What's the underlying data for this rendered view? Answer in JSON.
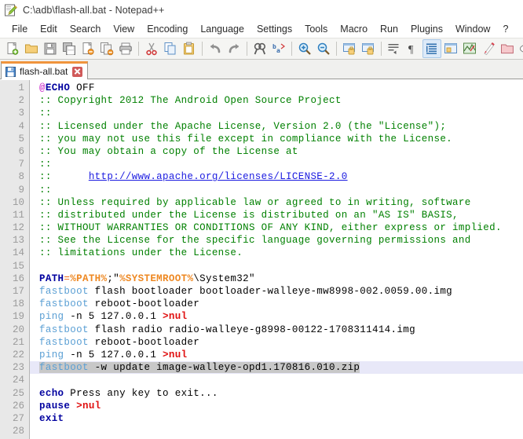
{
  "window": {
    "title": "C:\\adb\\flash-all.bat - Notepad++",
    "app_icon": "notepad-plus-plus-icon"
  },
  "menubar": {
    "items": [
      {
        "label": "File"
      },
      {
        "label": "Edit"
      },
      {
        "label": "Search"
      },
      {
        "label": "View"
      },
      {
        "label": "Encoding"
      },
      {
        "label": "Language"
      },
      {
        "label": "Settings"
      },
      {
        "label": "Tools"
      },
      {
        "label": "Macro"
      },
      {
        "label": "Run"
      },
      {
        "label": "Plugins"
      },
      {
        "label": "Window"
      },
      {
        "label": "?"
      }
    ]
  },
  "toolbar": {
    "buttons": [
      {
        "name": "new-file-icon"
      },
      {
        "name": "open-file-icon"
      },
      {
        "name": "save-icon"
      },
      {
        "name": "save-all-icon"
      },
      {
        "name": "close-file-icon"
      },
      {
        "name": "close-all-files-icon"
      },
      {
        "name": "print-icon"
      },
      {
        "name": "separator"
      },
      {
        "name": "cut-icon"
      },
      {
        "name": "copy-icon"
      },
      {
        "name": "paste-icon"
      },
      {
        "name": "separator"
      },
      {
        "name": "undo-icon"
      },
      {
        "name": "redo-icon"
      },
      {
        "name": "separator"
      },
      {
        "name": "find-icon"
      },
      {
        "name": "replace-icon"
      },
      {
        "name": "separator"
      },
      {
        "name": "zoom-in-icon"
      },
      {
        "name": "zoom-out-icon"
      },
      {
        "name": "separator"
      },
      {
        "name": "sync-vertical-scrolling-icon"
      },
      {
        "name": "sync-horizontal-scrolling-icon"
      },
      {
        "name": "separator"
      },
      {
        "name": "word-wrap-icon"
      },
      {
        "name": "show-all-characters-icon"
      },
      {
        "name": "indent-guide-icon"
      },
      {
        "name": "user-defined-language-icon"
      },
      {
        "name": "document-map-icon"
      },
      {
        "name": "function-list-icon"
      },
      {
        "name": "folder-as-workspace-icon"
      },
      {
        "name": "monitoring-icon"
      },
      {
        "name": "separator"
      },
      {
        "name": "record-macro-icon"
      }
    ]
  },
  "tabbar": {
    "tabs": [
      {
        "label": "flash-all.bat",
        "icon": "saved-file-icon",
        "close": "close-tab-icon",
        "active": true
      }
    ]
  },
  "editor": {
    "current_line": 23,
    "lines": [
      {
        "n": 1,
        "tokens": [
          {
            "t": "at",
            "s": "@"
          },
          {
            "t": "kw",
            "s": "ECHO"
          },
          {
            "t": "plain",
            "s": " OFF"
          }
        ]
      },
      {
        "n": 2,
        "tokens": [
          {
            "t": "cmt",
            "s": ":: Copyright 2012 The Android Open Source Project"
          }
        ]
      },
      {
        "n": 3,
        "tokens": [
          {
            "t": "cmt",
            "s": "::"
          }
        ]
      },
      {
        "n": 4,
        "tokens": [
          {
            "t": "cmt",
            "s": ":: Licensed under the Apache License, Version 2.0 (the \"License\");"
          }
        ]
      },
      {
        "n": 5,
        "tokens": [
          {
            "t": "cmt",
            "s": ":: you may not use this file except in compliance with the License."
          }
        ]
      },
      {
        "n": 6,
        "tokens": [
          {
            "t": "cmt",
            "s": ":: You may obtain a copy of the License at"
          }
        ]
      },
      {
        "n": 7,
        "tokens": [
          {
            "t": "cmt",
            "s": "::"
          }
        ]
      },
      {
        "n": 8,
        "tokens": [
          {
            "t": "cmt",
            "s": "::      "
          },
          {
            "t": "link",
            "s": "http://www.apache.org/licenses/LICENSE-2.0"
          }
        ]
      },
      {
        "n": 9,
        "tokens": [
          {
            "t": "cmt",
            "s": "::"
          }
        ]
      },
      {
        "n": 10,
        "tokens": [
          {
            "t": "cmt",
            "s": ":: Unless required by applicable law or agreed to in writing, software"
          }
        ]
      },
      {
        "n": 11,
        "tokens": [
          {
            "t": "cmt",
            "s": ":: distributed under the License is distributed on an \"AS IS\" BASIS,"
          }
        ]
      },
      {
        "n": 12,
        "tokens": [
          {
            "t": "cmt",
            "s": ":: WITHOUT WARRANTIES OR CONDITIONS OF ANY KIND, either express or implied."
          }
        ]
      },
      {
        "n": 13,
        "tokens": [
          {
            "t": "cmt",
            "s": ":: See the License for the specific language governing permissions and"
          }
        ]
      },
      {
        "n": 14,
        "tokens": [
          {
            "t": "cmt",
            "s": ":: limitations under the License."
          }
        ]
      },
      {
        "n": 15,
        "tokens": []
      },
      {
        "n": 16,
        "tokens": [
          {
            "t": "kw",
            "s": "PATH"
          },
          {
            "t": "op",
            "s": "="
          },
          {
            "t": "var",
            "s": "%PATH%"
          },
          {
            "t": "plain",
            "s": ";\""
          },
          {
            "t": "var",
            "s": "%SYSTEMROOT%"
          },
          {
            "t": "plain",
            "s": "\\System32\""
          }
        ]
      },
      {
        "n": 17,
        "tokens": [
          {
            "t": "cmd",
            "s": "fastboot"
          },
          {
            "t": "plain",
            "s": " flash bootloader bootloader-walleye-mw8998-002.0059.00.img"
          }
        ]
      },
      {
        "n": 18,
        "tokens": [
          {
            "t": "cmd",
            "s": "fastboot"
          },
          {
            "t": "plain",
            "s": " reboot-bootloader"
          }
        ]
      },
      {
        "n": 19,
        "tokens": [
          {
            "t": "cmd",
            "s": "ping"
          },
          {
            "t": "plain",
            "s": " -n 5 127.0.0.1 "
          },
          {
            "t": "red",
            "s": ">nul"
          }
        ]
      },
      {
        "n": 20,
        "tokens": [
          {
            "t": "cmd",
            "s": "fastboot"
          },
          {
            "t": "plain",
            "s": " flash radio radio-walleye-g8998-00122-1708311414.img"
          }
        ]
      },
      {
        "n": 21,
        "tokens": [
          {
            "t": "cmd",
            "s": "fastboot"
          },
          {
            "t": "plain",
            "s": " reboot-bootloader"
          }
        ]
      },
      {
        "n": 22,
        "tokens": [
          {
            "t": "cmd",
            "s": "ping"
          },
          {
            "t": "plain",
            "s": " -n 5 127.0.0.1 "
          },
          {
            "t": "red",
            "s": ">nul"
          }
        ]
      },
      {
        "n": 23,
        "tokens": [
          {
            "t": "cmd",
            "s": "fastboot",
            "sel": true
          },
          {
            "t": "plain",
            "s": " -w update image-walleye-opd1.170816.010.zip",
            "sel": true
          }
        ],
        "current": true
      },
      {
        "n": 24,
        "tokens": []
      },
      {
        "n": 25,
        "tokens": [
          {
            "t": "kw",
            "s": "echo"
          },
          {
            "t": "plain",
            "s": " Press any key to exit..."
          }
        ]
      },
      {
        "n": 26,
        "tokens": [
          {
            "t": "kw",
            "s": "pause"
          },
          {
            "t": "plain",
            "s": " "
          },
          {
            "t": "red",
            "s": ">nul"
          }
        ]
      },
      {
        "n": 27,
        "tokens": [
          {
            "t": "kw",
            "s": "exit"
          }
        ]
      },
      {
        "n": 28,
        "tokens": []
      }
    ]
  },
  "colors": {
    "comment": "#008000",
    "keyword": "#00009f",
    "command": "#5a9fd4",
    "variable": "#ee8822",
    "redirect": "#e01010",
    "link": "#1a1ae0",
    "tab_accent": "#f0943c",
    "current_line_bg": "#e8e8f8",
    "gutter_bg": "#e8e8e8"
  }
}
